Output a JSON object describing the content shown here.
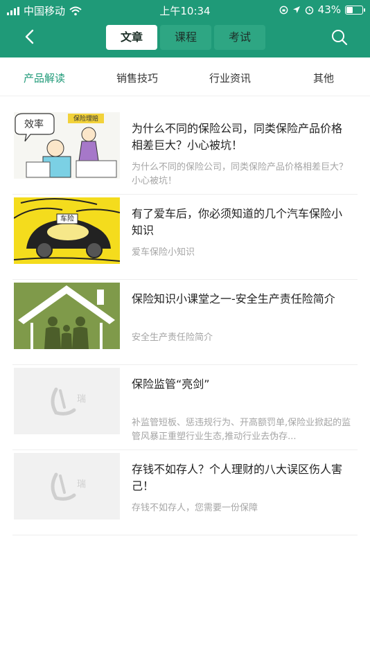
{
  "status_bar": {
    "carrier": "中国移动",
    "time": "上午10:34",
    "battery": "43%",
    "battery_level": 0.43
  },
  "nav": {
    "tabs": [
      {
        "label": "文章"
      },
      {
        "label": "课程"
      },
      {
        "label": "考试"
      }
    ],
    "active_tab_index": 0
  },
  "categories": [
    {
      "label": "产品解读"
    },
    {
      "label": "销售技巧"
    },
    {
      "label": "行业资讯"
    },
    {
      "label": "其他"
    }
  ],
  "active_category_index": 0,
  "articles": [
    {
      "title": "为什么不同的保险公司，同类保险产品价格相差巨大？小心被坑！",
      "summary": "为什么不同的保险公司，同类保险产品价格相差巨大？小心被坑！",
      "thumb_text_1": "效率",
      "thumb_text_2": "保险理赔"
    },
    {
      "title": "有了爱车后，你必须知道的几个汽车保险小知识",
      "summary": "爱车保险小知识",
      "thumb_text_1": "车险"
    },
    {
      "title": "保险知识小课堂之一-安全生产责任险简介",
      "summary": "安全生产责任险简介"
    },
    {
      "title": "保险监管“亮剑”",
      "summary": "补监管短板、惩违规行为、开高额罚单,保险业掀起的监管风暴正重塑行业生态,推动行业去伪存...",
      "thumb_text_1": "瑞"
    },
    {
      "title": "存钱不如存人？个人理财的八大误区伤人害己！",
      "summary": "存钱不如存人，您需要一份保障",
      "thumb_text_1": "瑞"
    }
  ],
  "colors": {
    "brand": "#1f9a78",
    "active_category": "#1f9a78"
  }
}
